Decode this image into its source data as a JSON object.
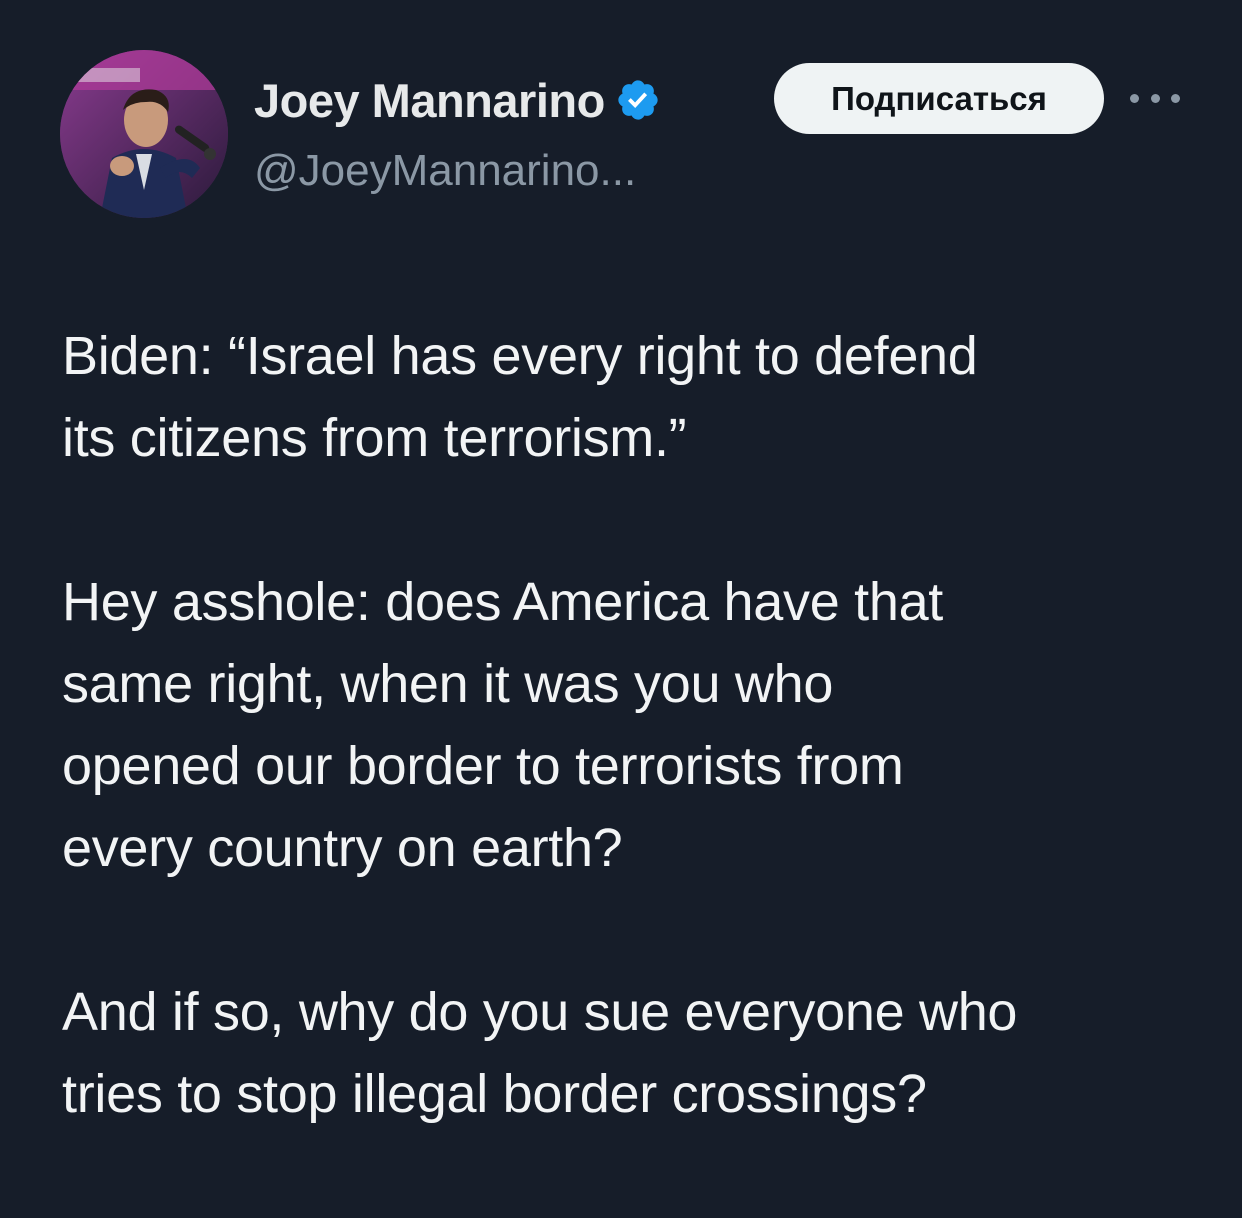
{
  "author": {
    "display_name": "Joey Mannarino",
    "handle": "@JoeyMannarino...",
    "verified": true,
    "avatar_icon": "profile-photo-speaker-with-microphone",
    "verified_icon": "verified-badge-icon"
  },
  "header": {
    "follow_label": "Подписаться",
    "more_icon": "more-options-icon"
  },
  "tweet": {
    "paragraphs": [
      "Biden: “Israel has every right to defend\nits citizens from terrorism.”",
      "Hey asshole: does America have that\nsame right, when it was you who\nopened our border to terrorists from\nevery country on earth?",
      "And if so, why do you sue everyone who\ntries to stop illegal border crossings?"
    ]
  },
  "colors": {
    "background": "#161d29",
    "text_primary": "#e7e9ea",
    "text_secondary": "#8b98a5",
    "verified_blue": "#1d9bf0",
    "button_bg": "#eff3f4"
  }
}
